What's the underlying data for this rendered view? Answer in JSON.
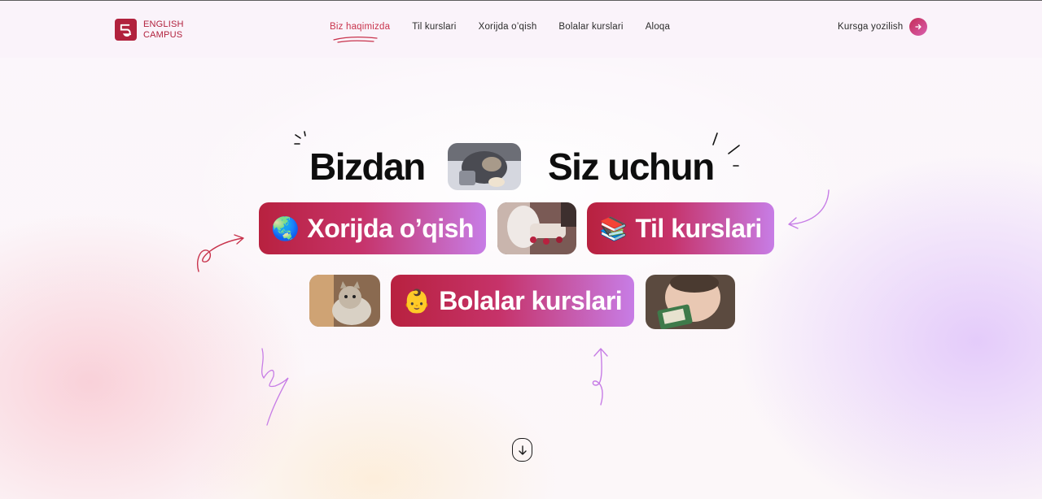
{
  "brand": {
    "line1": "ENGLISH",
    "line2": "CAMPUS",
    "color": "#b1213d"
  },
  "nav": {
    "items": [
      {
        "label": "Biz haqimizda",
        "active": true
      },
      {
        "label": "Til kurslari",
        "active": false
      },
      {
        "label": "Xorijda o’qish",
        "active": false
      },
      {
        "label": "Bolalar kurslari",
        "active": false
      },
      {
        "label": "Aloqa",
        "active": false
      }
    ]
  },
  "cta": {
    "label": "Kursga yozilish",
    "icon": "arrow-right-icon"
  },
  "hero": {
    "word1": "Bizdan",
    "word2": "Siz uchun",
    "pills": [
      {
        "emoji": "🌏",
        "label": "Xorijda o’qish"
      },
      {
        "emoji": "📚",
        "label": "Til kurslari"
      },
      {
        "emoji": "👶",
        "label": "Bolalar kurslari"
      }
    ]
  },
  "scroll": {
    "icon": "arrow-down-icon"
  },
  "colors": {
    "accent": "#b8213f",
    "accent_end": "#c77de6",
    "nav_active": "#c8334c",
    "text": "#0e0e0e"
  }
}
